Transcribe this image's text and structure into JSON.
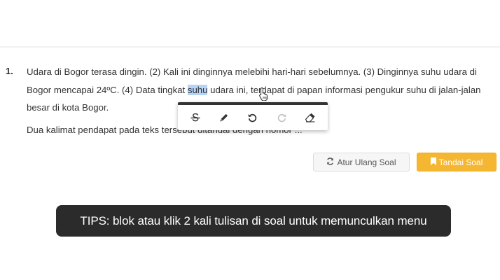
{
  "question": {
    "number": "1.",
    "text_before": "Udara di Bogor terasa dingin. (2) Kali ini dinginnya melebihi hari-hari sebelumnya. (3) Dinginnya suhu udara di Bogor mencapai 24ºC. (4) Data tingkat ",
    "selected_word": "suhu",
    "text_after": " udara ini, terdapat di papan informasi pengukur suhu di jalan-jalan besar di kota Bogor.",
    "prompt": "Dua kalimat pendapat pada teks tersebut ditandai dengan nomor ..."
  },
  "toolbar": {
    "tools": [
      "strikethrough-icon",
      "pencil-icon",
      "undo-icon",
      "redo-icon",
      "eraser-icon"
    ],
    "redo_disabled": true
  },
  "actions": {
    "reset_label": "Atur Ulang Soal",
    "mark_label": "Tandai Soal"
  },
  "tips": {
    "text": "TIPS: blok atau klik 2 kali tulisan di soal untuk memunculkan menu"
  },
  "colors": {
    "accent": "#f5b731",
    "selection": "#b7d4f7",
    "tips_bg": "#2b2b2b"
  }
}
